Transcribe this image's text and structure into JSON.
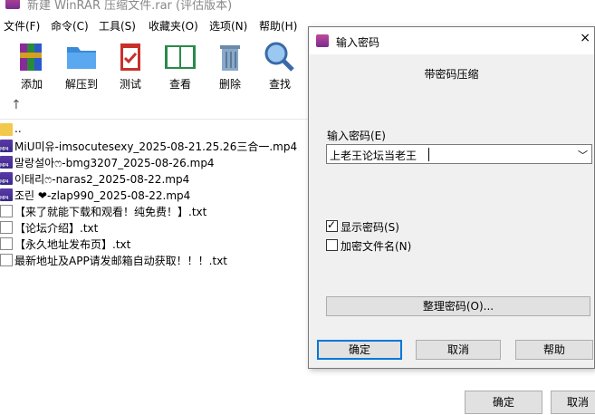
{
  "window": {
    "title": "新建 WinRAR 压缩文件.rar (评估版本)"
  },
  "menu": [
    "文件(F)",
    "命令(C)",
    "工具(S)",
    "收藏夹(O)",
    "选项(N)",
    "帮助(H)"
  ],
  "toolbar": [
    "添加",
    "解压到",
    "测试",
    "查看",
    "删除",
    "查找"
  ],
  "up_icon": "↑",
  "files": [
    {
      "name": "..",
      "kind": "folder"
    },
    {
      "name": "MiU미유-imsocutesexy_2025-08-21.25.26三合一.mp4",
      "kind": "mp4"
    },
    {
      "name": "말랑설아ෆ-bmg3207_2025-08-26.mp4",
      "kind": "mp4"
    },
    {
      "name": "이태리ෆ-naras2_2025-08-22.mp4",
      "kind": "mp4"
    },
    {
      "name": "조린 ❤-zlap990_2025-08-22.mp4",
      "kind": "mp4"
    },
    {
      "name": "【来了就能下载和观看！纯免费！】.txt",
      "kind": "txt"
    },
    {
      "name": "【论坛介绍】.txt",
      "kind": "txt"
    },
    {
      "name": "【永久地址发布页】.txt",
      "kind": "txt"
    },
    {
      "name": "最新地址及APP请发邮箱自动获取！！！.txt",
      "kind": "txt"
    }
  ],
  "bg_buttons": {
    "ok": "确定",
    "cancel": "取消"
  },
  "dialog": {
    "title": "输入密码",
    "close": "×",
    "tab_title": "带密码压缩",
    "password_label": "输入密码(E)",
    "password_value": "上老王论坛当老王",
    "dropdown_icon": "﹀",
    "show_password": {
      "label": "显示密码(S)",
      "checked": true
    },
    "encrypt_names": {
      "label": "加密文件名(N)",
      "checked": false
    },
    "organize_button": "整理密码(O)...",
    "ok": "确定",
    "cancel": "取消",
    "help": "帮助"
  }
}
